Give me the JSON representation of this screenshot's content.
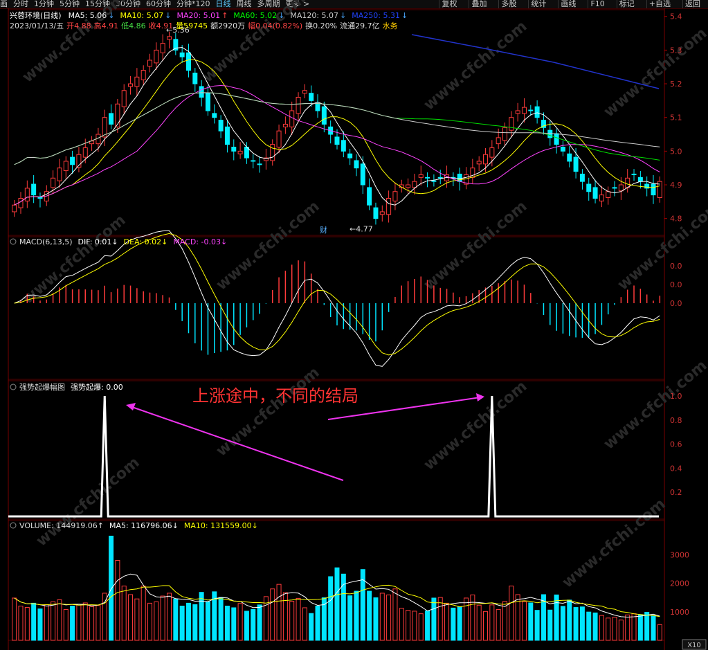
{
  "toolbar": {
    "tabs": [
      "画",
      "分时",
      "1分钟",
      "5分钟",
      "15分钟",
      "30分钟",
      "60分钟",
      "分钟*120",
      "日线",
      "周线",
      "多周期",
      "更多 >"
    ],
    "active_tab": "日线",
    "right_buttons": [
      "复权",
      "叠加",
      "多股",
      "统计",
      "画线",
      "F10",
      "标记",
      "+自选",
      "返回"
    ]
  },
  "header": {
    "stock": "兴蓉环境(日线)",
    "ma": [
      {
        "label": "MA5: 5.06",
        "arrow": "↓",
        "color": "#ffffff"
      },
      {
        "label": "MA10: 5.07",
        "arrow": "↓",
        "color": "#ffff00"
      },
      {
        "label": "MA20: 5.01",
        "arrow": "↑",
        "color": "#ff44ff"
      },
      {
        "label": "MA60: 5.02",
        "arrow": "↓",
        "color": "#00ff00"
      },
      {
        "label": "MA120: 5.07",
        "arrow": "↓",
        "color": "#cccccc"
      },
      {
        "label": "MA250: 5.31",
        "arrow": "↓",
        "color": "#2244ff"
      }
    ],
    "info": [
      {
        "t": "2023/01/13/五",
        "c": "#dddddd"
      },
      {
        "t": "开4.88",
        "c": "#ff4444"
      },
      {
        "t": "高4.91",
        "c": "#ff4444"
      },
      {
        "t": "低4.86",
        "c": "#44dd44"
      },
      {
        "t": "收4.91",
        "c": "#ff4444"
      },
      {
        "t": "量59745",
        "c": "#ffff00"
      },
      {
        "t": "额2920万",
        "c": "#dddddd"
      },
      {
        "t": "幅0.04(0.82%)",
        "c": "#ff4444"
      },
      {
        "t": "换0.20%",
        "c": "#dddddd"
      },
      {
        "t": "流通29.7亿",
        "c": "#dddddd"
      },
      {
        "t": "水务",
        "c": "#ffcc00"
      }
    ]
  },
  "macd_header": [
    {
      "t": "MACD(6,13,5)",
      "c": "#dddddd"
    },
    {
      "t": "DIF: 0.01↓",
      "c": "#ffffff"
    },
    {
      "t": "DEA: 0.02↓",
      "c": "#ffff00"
    },
    {
      "t": "MACD: -0.03↓",
      "c": "#ff44ff"
    }
  ],
  "signal_header": [
    {
      "t": "强势起爆幅图",
      "c": "#dddddd"
    },
    {
      "t": "强势起爆: 0.00",
      "c": "#ffffff"
    }
  ],
  "volume_header": [
    {
      "t": "VOLUME: 144919.06↑",
      "c": "#dddddd"
    },
    {
      "t": "MA5: 116796.06↓",
      "c": "#ffffff"
    },
    {
      "t": "MA10: 131559.00↓",
      "c": "#ffff00"
    }
  ],
  "annotation": "上涨途中，不同的结局",
  "finance_marker": "财",
  "watermark": "www.cfchi.com",
  "volume_unit": "X10",
  "chart_data": {
    "type": "candlestick",
    "price_axis": {
      "ticks": [
        4.8,
        4.9,
        5.0,
        5.1,
        5.2,
        5.3,
        5.4
      ],
      "range": [
        4.75,
        5.42
      ]
    },
    "high_label": "5.36",
    "low_label": "4.77",
    "closes": [
      4.84,
      4.86,
      4.89,
      4.87,
      4.86,
      4.88,
      4.92,
      4.95,
      4.97,
      4.96,
      4.99,
      5.01,
      5.03,
      5.05,
      5.1,
      5.08,
      5.14,
      5.18,
      5.2,
      5.22,
      5.24,
      5.27,
      5.3,
      5.32,
      5.34,
      5.3,
      5.28,
      5.24,
      5.2,
      5.16,
      5.12,
      5.1,
      5.06,
      5.02,
      5.0,
      5.0,
      4.98,
      4.97,
      4.96,
      4.98,
      5.02,
      5.06,
      5.08,
      5.12,
      5.16,
      5.18,
      5.15,
      5.12,
      5.08,
      5.05,
      5.02,
      5.0,
      4.98,
      4.95,
      4.9,
      4.84,
      4.8,
      4.82,
      4.86,
      4.88,
      4.9,
      4.9,
      4.91,
      4.93,
      4.92,
      4.91,
      4.92,
      4.93,
      4.92,
      4.91,
      4.93,
      4.95,
      4.97,
      4.99,
      5.01,
      5.04,
      5.07,
      5.1,
      5.12,
      5.13,
      5.12,
      5.1,
      5.07,
      5.04,
      5.02,
      5.0,
      4.97,
      4.94,
      4.91,
      4.88,
      4.86,
      4.87,
      4.88,
      4.89,
      4.9,
      4.92,
      4.93,
      4.91,
      4.89,
      4.87,
      4.91
    ],
    "macd_axis": {
      "ticks": [
        "0.0",
        "0.0",
        "0.0"
      ]
    },
    "signal_axis": {
      "ticks": [
        0.2,
        0.4,
        0.6,
        0.8,
        1.0
      ],
      "range": [
        0,
        1
      ]
    },
    "signal_spikes": [
      {
        "index": 14,
        "value": 1.0
      },
      {
        "index": 74,
        "value": 1.0
      }
    ],
    "volume_axis": {
      "ticks": [
        1000,
        2000,
        3000
      ],
      "range": [
        0,
        4000
      ]
    },
    "volumes": [
      1480,
      1200,
      1150,
      1300,
      1100,
      1250,
      1350,
      1420,
      1080,
      1200,
      1260,
      1310,
      1180,
      1220,
      1650,
      3650,
      2800,
      1900,
      1600,
      1450,
      1900,
      1300,
      1350,
      1550,
      1650,
      1450,
      1200,
      1300,
      1250,
      1680,
      1350,
      1700,
      1500,
      1200,
      1140,
      1290,
      1020,
      1080,
      1240,
      1530,
      1800,
      1960,
      1670,
      1370,
      1470,
      1140,
      940,
      1200,
      1490,
      2230,
      2540,
      2320,
      1560,
      1720,
      2480,
      1720,
      1490,
      1650,
      1590,
      1800,
      1120,
      1050,
      1020,
      930,
      1030,
      1480,
      1500,
      1300,
      1130,
      1170,
      1480,
      1590,
      1230,
      1010,
      1240,
      1080,
      1360,
      1900,
      1600,
      1350,
      1310,
      1050,
      1600,
      1060,
      1590,
      1190,
      1410,
      1150,
      1170,
      990,
      960,
      870,
      780,
      810,
      710,
      890,
      930,
      900,
      980,
      870,
      550
    ]
  }
}
